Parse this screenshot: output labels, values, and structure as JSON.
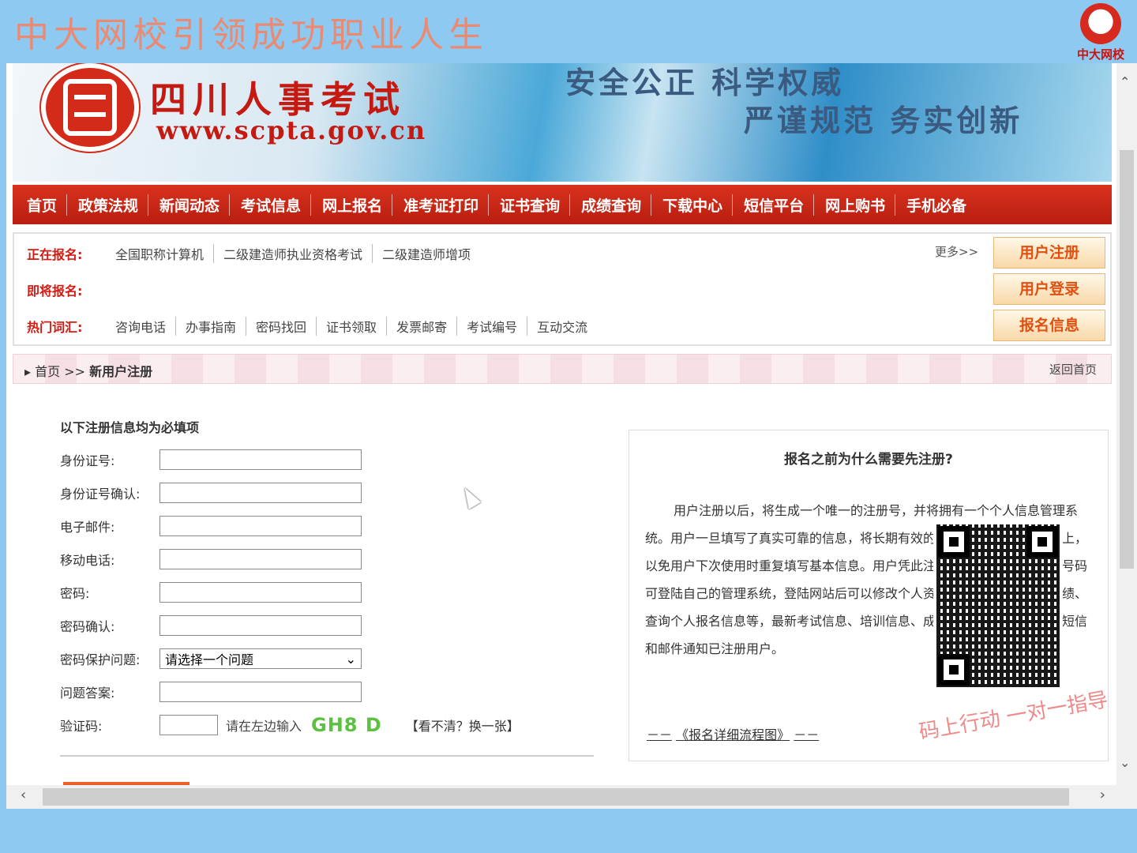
{
  "overlay": {
    "top_slogan": "中大网校引领成功职业人生",
    "brand_logo_text": "中大网校",
    "qr_slogan": "码上行动 一对一指导"
  },
  "banner": {
    "site_name": "四川人事考试",
    "site_url": "www.scpta.gov.cn",
    "motto_1": "安全公正 科学权威",
    "motto_2": "严谨规范 务实创新"
  },
  "nav": {
    "items": [
      "首页",
      "政策法规",
      "新闻动态",
      "考试信息",
      "网上报名",
      "准考证打印",
      "证书查询",
      "成绩查询",
      "下载中心",
      "短信平台",
      "网上购书",
      "手机必备"
    ]
  },
  "info": {
    "registering_label": "正在报名:",
    "registering_links": [
      "全国职称计算机",
      "二级建造师执业资格考试",
      "二级建造师增项"
    ],
    "upcoming_label": "即将报名:",
    "hot_label": "热门词汇:",
    "hot_links": [
      "咨询电话",
      "办事指南",
      "密码找回",
      "证书领取",
      "发票邮寄",
      "考试编号",
      "互动交流"
    ],
    "more": "更多>>",
    "side_buttons": [
      "用户注册",
      "用户登录",
      "报名信息"
    ]
  },
  "breadcrumb": {
    "home": "首页",
    "sep": ">>",
    "current": "新用户注册",
    "back": "返回首页"
  },
  "form": {
    "title": "以下注册信息均为必填项",
    "fields": [
      {
        "label": "身份证号:",
        "value": ""
      },
      {
        "label": "身份证号确认:",
        "value": ""
      },
      {
        "label": "电子邮件:",
        "value": ""
      },
      {
        "label": "移动电话:",
        "value": ""
      },
      {
        "label": "密码:",
        "value": ""
      },
      {
        "label": "密码确认:",
        "value": ""
      }
    ],
    "security_question_label": "密码保护问题:",
    "security_question_value": "请选择一个问题",
    "answer_label": "问题答案:",
    "captcha_label": "验证码:",
    "captcha_hint": "请在左边输入",
    "captcha_code": "GH8 D",
    "captcha_refresh": "【看不清？换一张】"
  },
  "notice": {
    "title": "报名之前为什么需要先注册?",
    "body": "用户注册以后，将生成一个唯一的注册号，并将拥有一个个人信息管理系统。用户一旦填写了真实可靠的信息，将长期有效的保存在四川人事考试网上，以免用户下次使用时重复填写基本信息。用户凭此注册号或电子邮件或手机号码可登陆自己的管理系统，登陆网站后可以修改个人资料、添加好友、查询成绩、查询个人报名信息等，最新考试信息、培训信息、成绩信息等有关信息通过短信和邮件通知已注册用户。",
    "link_prefix": "－－",
    "link_text": "《报名详细流程图》",
    "link_suffix": "－－"
  }
}
